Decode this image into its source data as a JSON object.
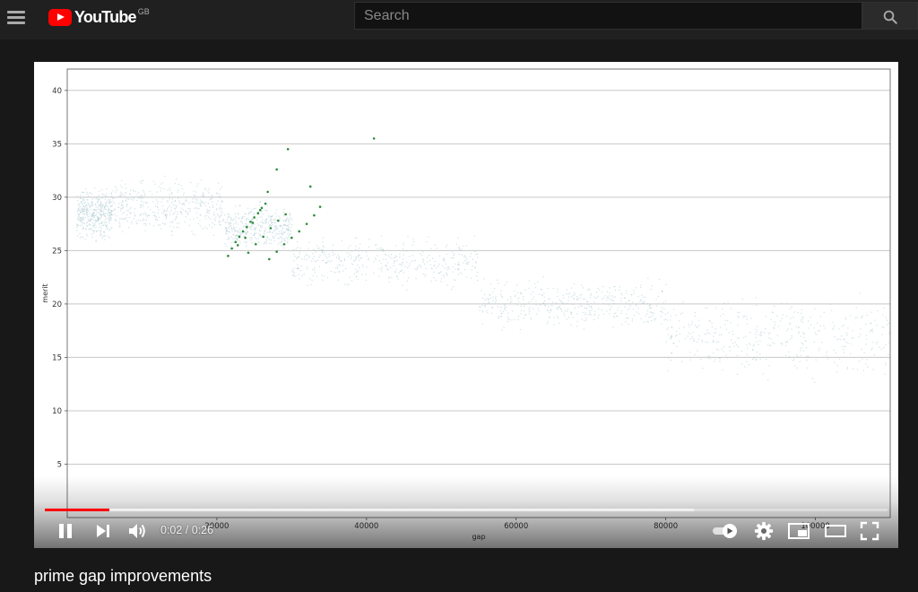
{
  "header": {
    "logo_text": "YouTube",
    "region": "GB",
    "search_placeholder": "Search"
  },
  "player": {
    "current_time": "0:02",
    "duration": "0:26",
    "time_display": "0:02 / 0:26",
    "played_fraction": 0.077,
    "buffered_fraction": 0.77,
    "autoplay_on": true,
    "progress_color": "#ff0000"
  },
  "video": {
    "title": "prime gap improvements"
  },
  "chart_data": {
    "type": "scatter",
    "xlabel": "gap",
    "ylabel": "merit",
    "xlim": [
      0,
      110000
    ],
    "ylim": [
      0,
      42
    ],
    "xticks": [
      "20000",
      "40000",
      "60000",
      "80000",
      "100000"
    ],
    "yticks": [
      "5",
      "10",
      "15",
      "20",
      "25",
      "30",
      "35",
      "40"
    ],
    "grid": "horizontal",
    "series": [
      {
        "color": "#a9c9d0",
        "clusters": [
          {
            "x": [
              1200,
              6000
            ],
            "y": [
              25.5,
              31.5
            ]
          },
          {
            "x": [
              6000,
              21000
            ],
            "y": [
              25.5,
              32.5
            ]
          },
          {
            "x": [
              21000,
              30000
            ],
            "y": [
              24.5,
              30
            ]
          },
          {
            "x": [
              30000,
              55000
            ],
            "y": [
              21,
              27
            ]
          },
          {
            "x": [
              55000,
              80000
            ],
            "y": [
              17,
              23
            ]
          },
          {
            "x": [
              80000,
              110000
            ],
            "y": [
              12,
              22
            ]
          }
        ]
      },
      {
        "color": "#2e8b3a",
        "points": [
          [
            21500,
            24.5
          ],
          [
            22000,
            25.2
          ],
          [
            22500,
            25.8
          ],
          [
            23000,
            26.3
          ],
          [
            23500,
            26.8
          ],
          [
            24000,
            27.2
          ],
          [
            24500,
            27.7
          ],
          [
            25000,
            28.1
          ],
          [
            25500,
            28.5
          ],
          [
            26000,
            29
          ],
          [
            26500,
            29.4
          ],
          [
            22800,
            25.5
          ],
          [
            23800,
            26.2
          ],
          [
            24800,
            27.6
          ],
          [
            25800,
            28.8
          ],
          [
            24200,
            24.8
          ],
          [
            25200,
            25.6
          ],
          [
            26200,
            26.3
          ],
          [
            27200,
            27.1
          ],
          [
            28200,
            27.8
          ],
          [
            29200,
            28.4
          ],
          [
            27000,
            24.2
          ],
          [
            28000,
            24.9
          ],
          [
            29000,
            25.6
          ],
          [
            30000,
            26.2
          ],
          [
            31000,
            26.8
          ],
          [
            32000,
            27.5
          ],
          [
            33000,
            28.3
          ],
          [
            33800,
            29.1
          ],
          [
            26800,
            30.5
          ],
          [
            28000,
            32.6
          ],
          [
            29500,
            34.5
          ],
          [
            32500,
            31
          ],
          [
            41000,
            35.5
          ]
        ]
      }
    ]
  }
}
